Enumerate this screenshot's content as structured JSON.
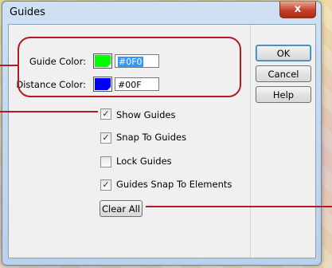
{
  "dialog": {
    "title": "Guides",
    "close_glyph": "x"
  },
  "colors": {
    "guide_color": "#00ff00",
    "distance_color": "#0000ff",
    "annotation_color": "#b31a24"
  },
  "fields": {
    "guide_color_label": "Guide Color:",
    "guide_color_value": "#0F0",
    "distance_color_label": "Distance Color:",
    "distance_color_value": "#00F"
  },
  "checkboxes": [
    {
      "label": "Show Guides",
      "checked": true
    },
    {
      "label": "Snap To Guides",
      "checked": true
    },
    {
      "label": "Lock Guides",
      "checked": false
    },
    {
      "label": "Guides Snap To Elements",
      "checked": true
    }
  ],
  "buttons": {
    "ok": "OK",
    "cancel": "Cancel",
    "help": "Help",
    "clear_all": "Clear All"
  }
}
